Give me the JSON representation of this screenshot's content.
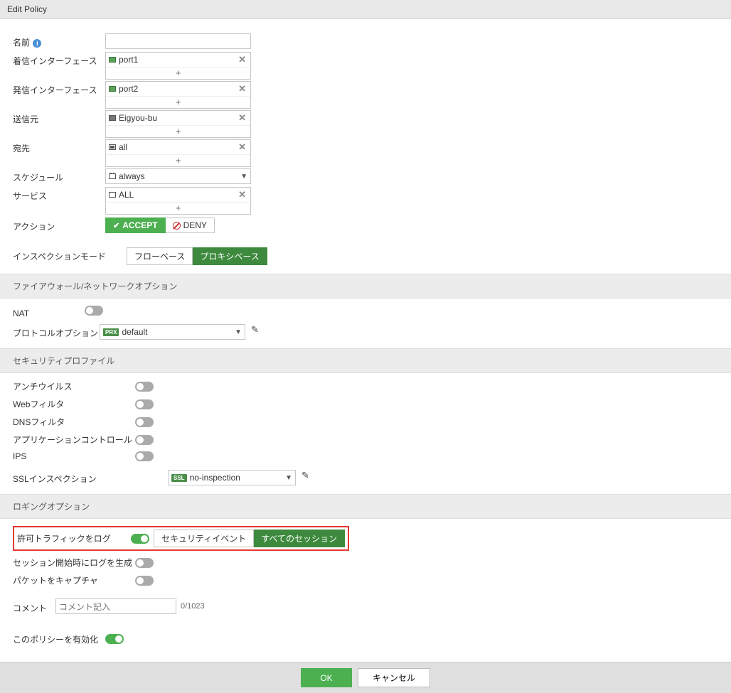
{
  "title": "Edit Policy",
  "fields": {
    "name_label": "名前",
    "incoming_label": "着信インターフェース",
    "incoming_value": "port1",
    "outgoing_label": "発信インターフェース",
    "outgoing_value": "port2",
    "source_label": "送信元",
    "source_value": "Eigyou-bu",
    "dest_label": "宛先",
    "dest_value": "all",
    "schedule_label": "スケジュール",
    "schedule_value": "always",
    "service_label": "サービス",
    "service_value": "ALL",
    "action_label": "アクション",
    "action_accept": "ACCEPT",
    "action_deny": "DENY",
    "inspection_label": "インスペクションモード",
    "inspection_flow": "フローベース",
    "inspection_proxy": "プロキシベース"
  },
  "sections": {
    "firewall": "ファイアウォール/ネットワークオプション",
    "security": "セキュリティプロファイル",
    "logging": "ロギングオプション"
  },
  "firewall": {
    "nat_label": "NAT",
    "protocol_label": "プロトコルオプション",
    "protocol_badge": "PRX",
    "protocol_value": "default"
  },
  "security": {
    "av": "アンチウイルス",
    "web": "Webフィルタ",
    "dns": "DNSフィルタ",
    "app": "アプリケーションコントロール",
    "ips": "IPS",
    "ssl_label": "SSLインスペクション",
    "ssl_badge": "SSL",
    "ssl_value": "no-inspection"
  },
  "logging": {
    "allowed_label": "許可トラフィックをログ",
    "security_events": "セキュリティイベント",
    "all_sessions": "すべてのセッション",
    "session_start": "セッション開始時にログを生成",
    "capture": "パケットをキャプチャ"
  },
  "comment": {
    "label": "コメント",
    "placeholder": "コメント記入",
    "counter": "0/1023"
  },
  "enable_label": "このポリシーを有効化",
  "footer": {
    "ok": "OK",
    "cancel": "キャンセル"
  }
}
